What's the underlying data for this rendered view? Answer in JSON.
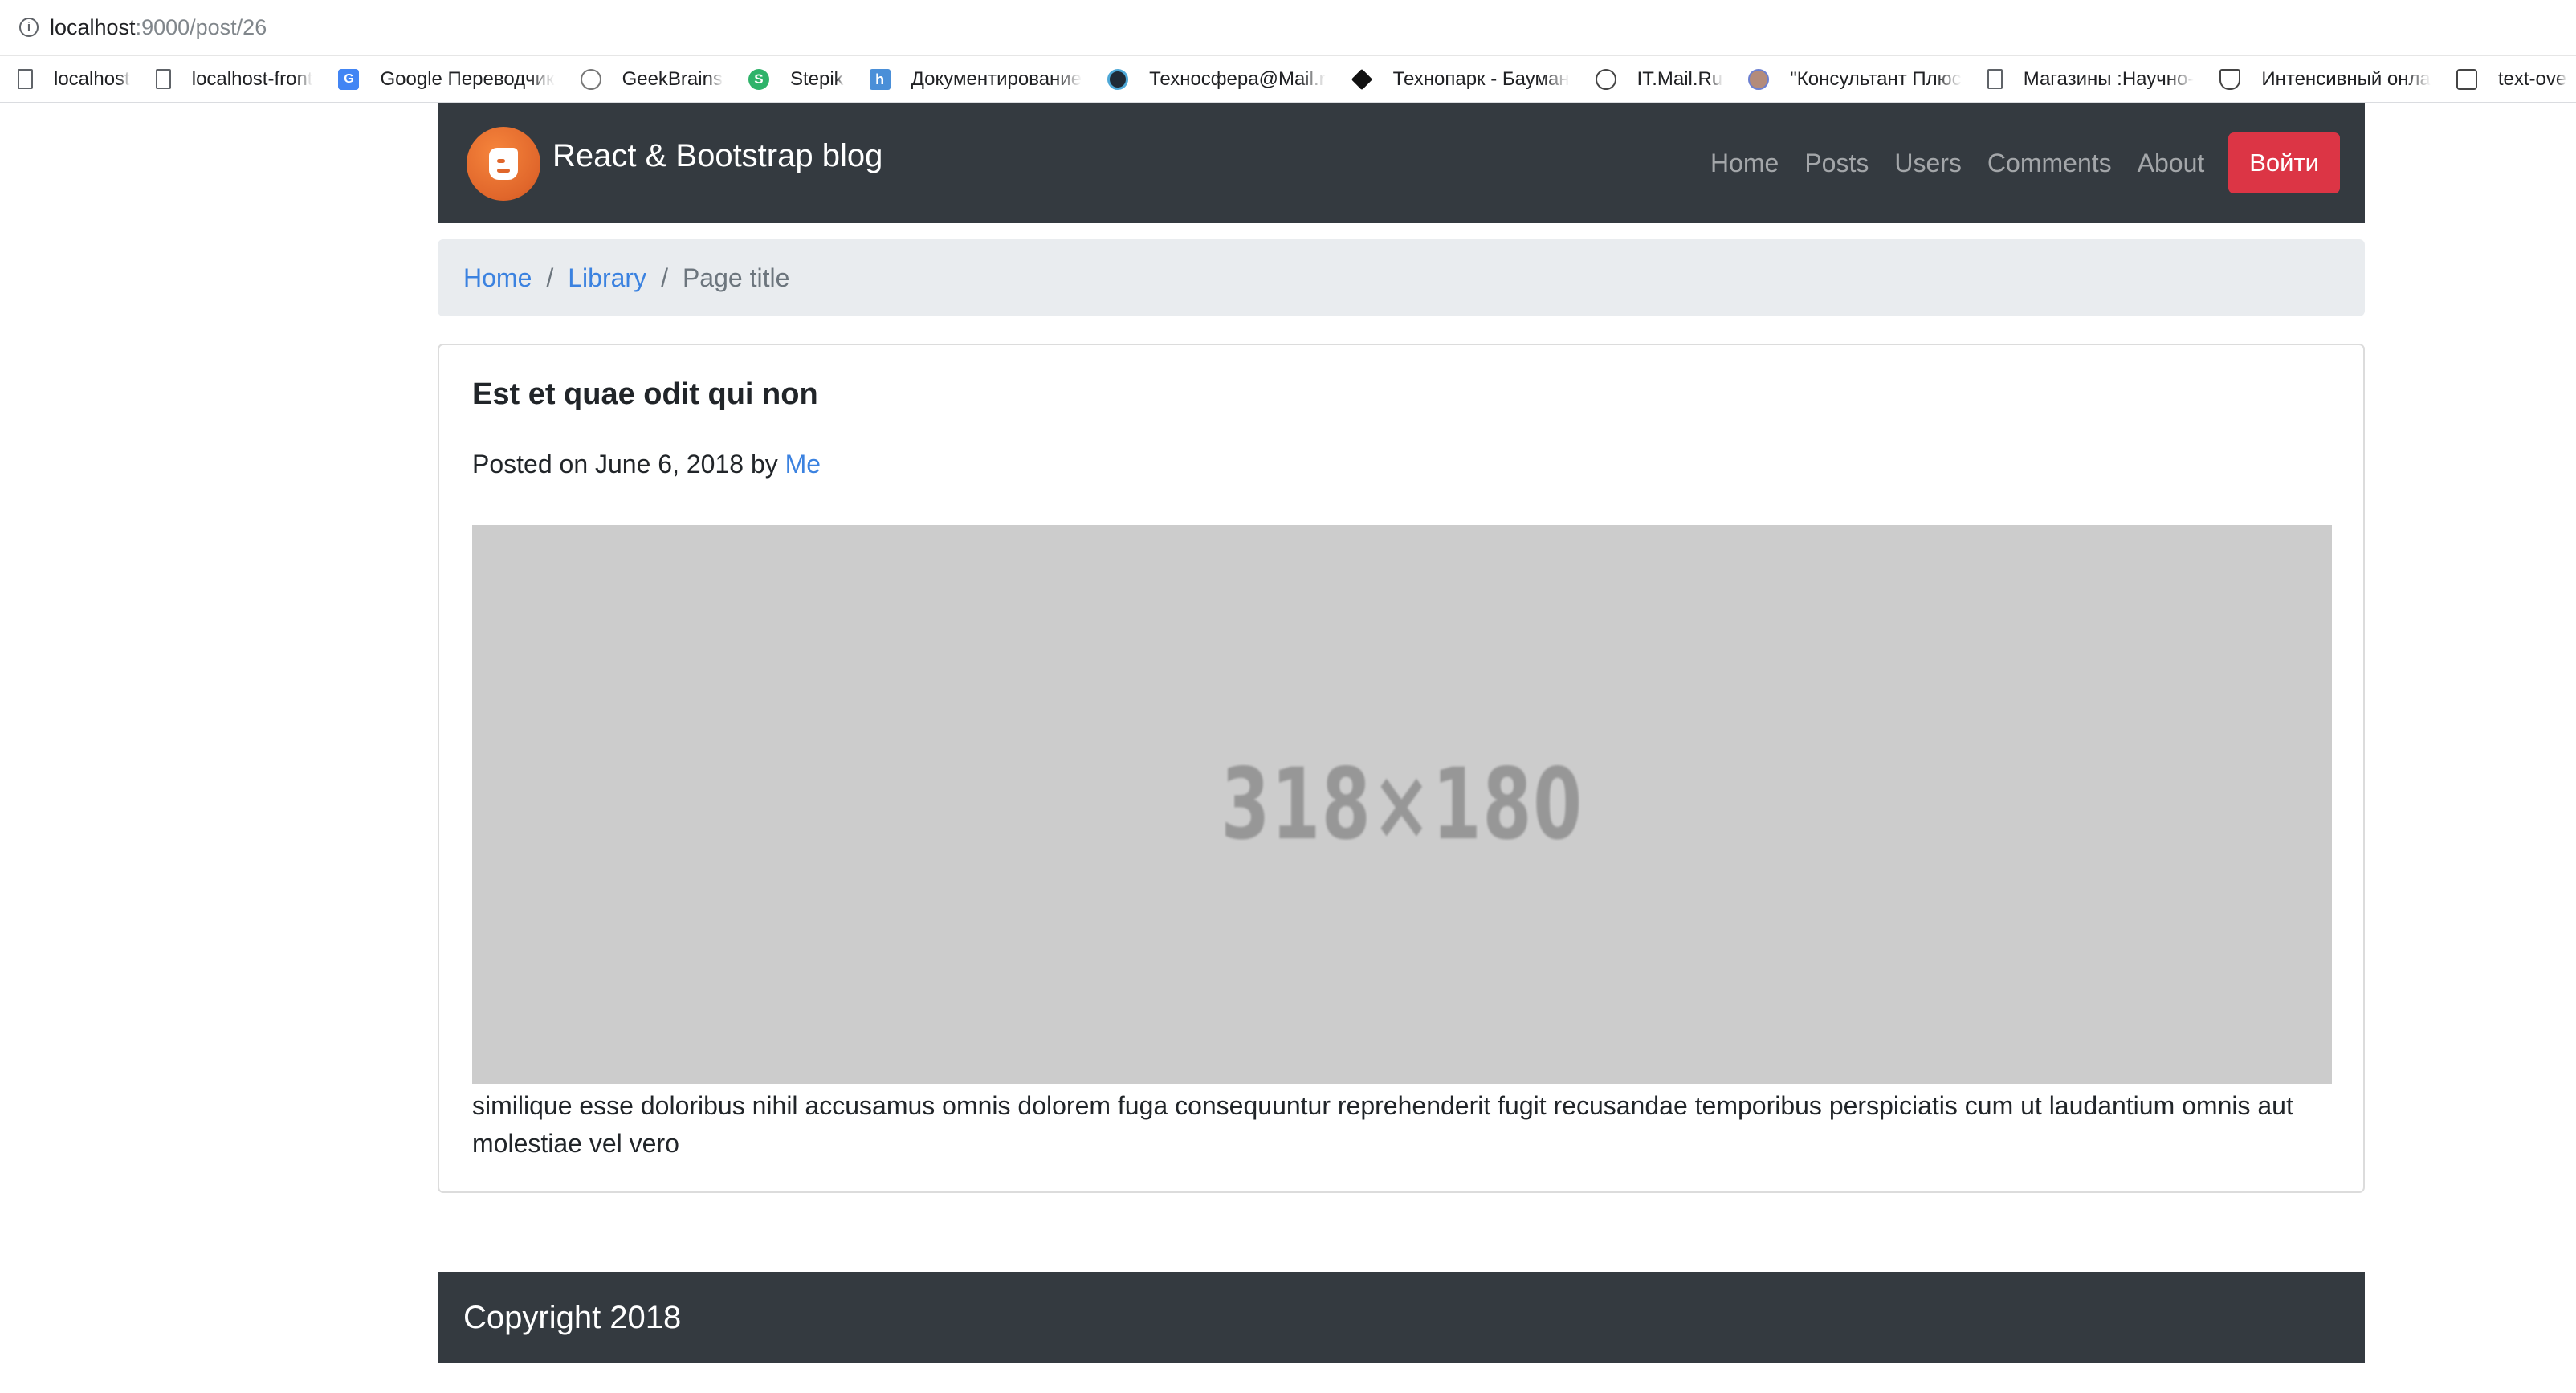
{
  "browser": {
    "url_host": "localhost",
    "url_rest": ":9000/post/26",
    "bookmarks": [
      {
        "label": "localhost",
        "icon": "page-icon"
      },
      {
        "label": "localhost-front",
        "icon": "page-icon"
      },
      {
        "label": "Google Переводчик",
        "icon": "google-translate-icon"
      },
      {
        "label": "GeekBrains",
        "icon": "geekbrains-icon"
      },
      {
        "label": "Stepik",
        "icon": "stepik-icon"
      },
      {
        "label": "Документирование",
        "icon": "h-icon"
      },
      {
        "label": "Техносфера@Mail.r",
        "icon": "globe-icon"
      },
      {
        "label": "Технопарк - Бауман",
        "icon": "diamond-icon"
      },
      {
        "label": "IT.Mail.Ru",
        "icon": "itmail-icon"
      },
      {
        "label": "\"Консультант Плюс",
        "icon": "avatar-icon"
      },
      {
        "label": "Магазины :Научно-",
        "icon": "page-icon"
      },
      {
        "label": "Интенсивный онла",
        "icon": "shield-icon"
      },
      {
        "label": "text-ove",
        "icon": "chat-icon"
      }
    ]
  },
  "navbar": {
    "brand": "React & Bootstrap blog",
    "links": [
      "Home",
      "Posts",
      "Users",
      "Comments",
      "About"
    ],
    "login": "Войти"
  },
  "breadcrumb": {
    "items": [
      "Home",
      "Library"
    ],
    "active": "Page title",
    "separator": "/"
  },
  "post": {
    "title": "Est et quae odit qui non",
    "posted_prefix": "Posted on June 6, 2018 by ",
    "author": "Me",
    "image_placeholder": "318×180",
    "body": "similique esse doloribus nihil accusamus omnis dolorem fuga consequuntur reprehenderit fugit recusandae temporibus perspiciatis cum ut laudantium omnis aut molestiae vel vero"
  },
  "footer": {
    "text": "Copyright 2018"
  },
  "colors": {
    "navbar_bg": "#343a40",
    "link": "#3b82e0",
    "danger": "#dc3545",
    "breadcrumb_bg": "#e9ecef",
    "placeholder_bg": "#cccccc"
  }
}
